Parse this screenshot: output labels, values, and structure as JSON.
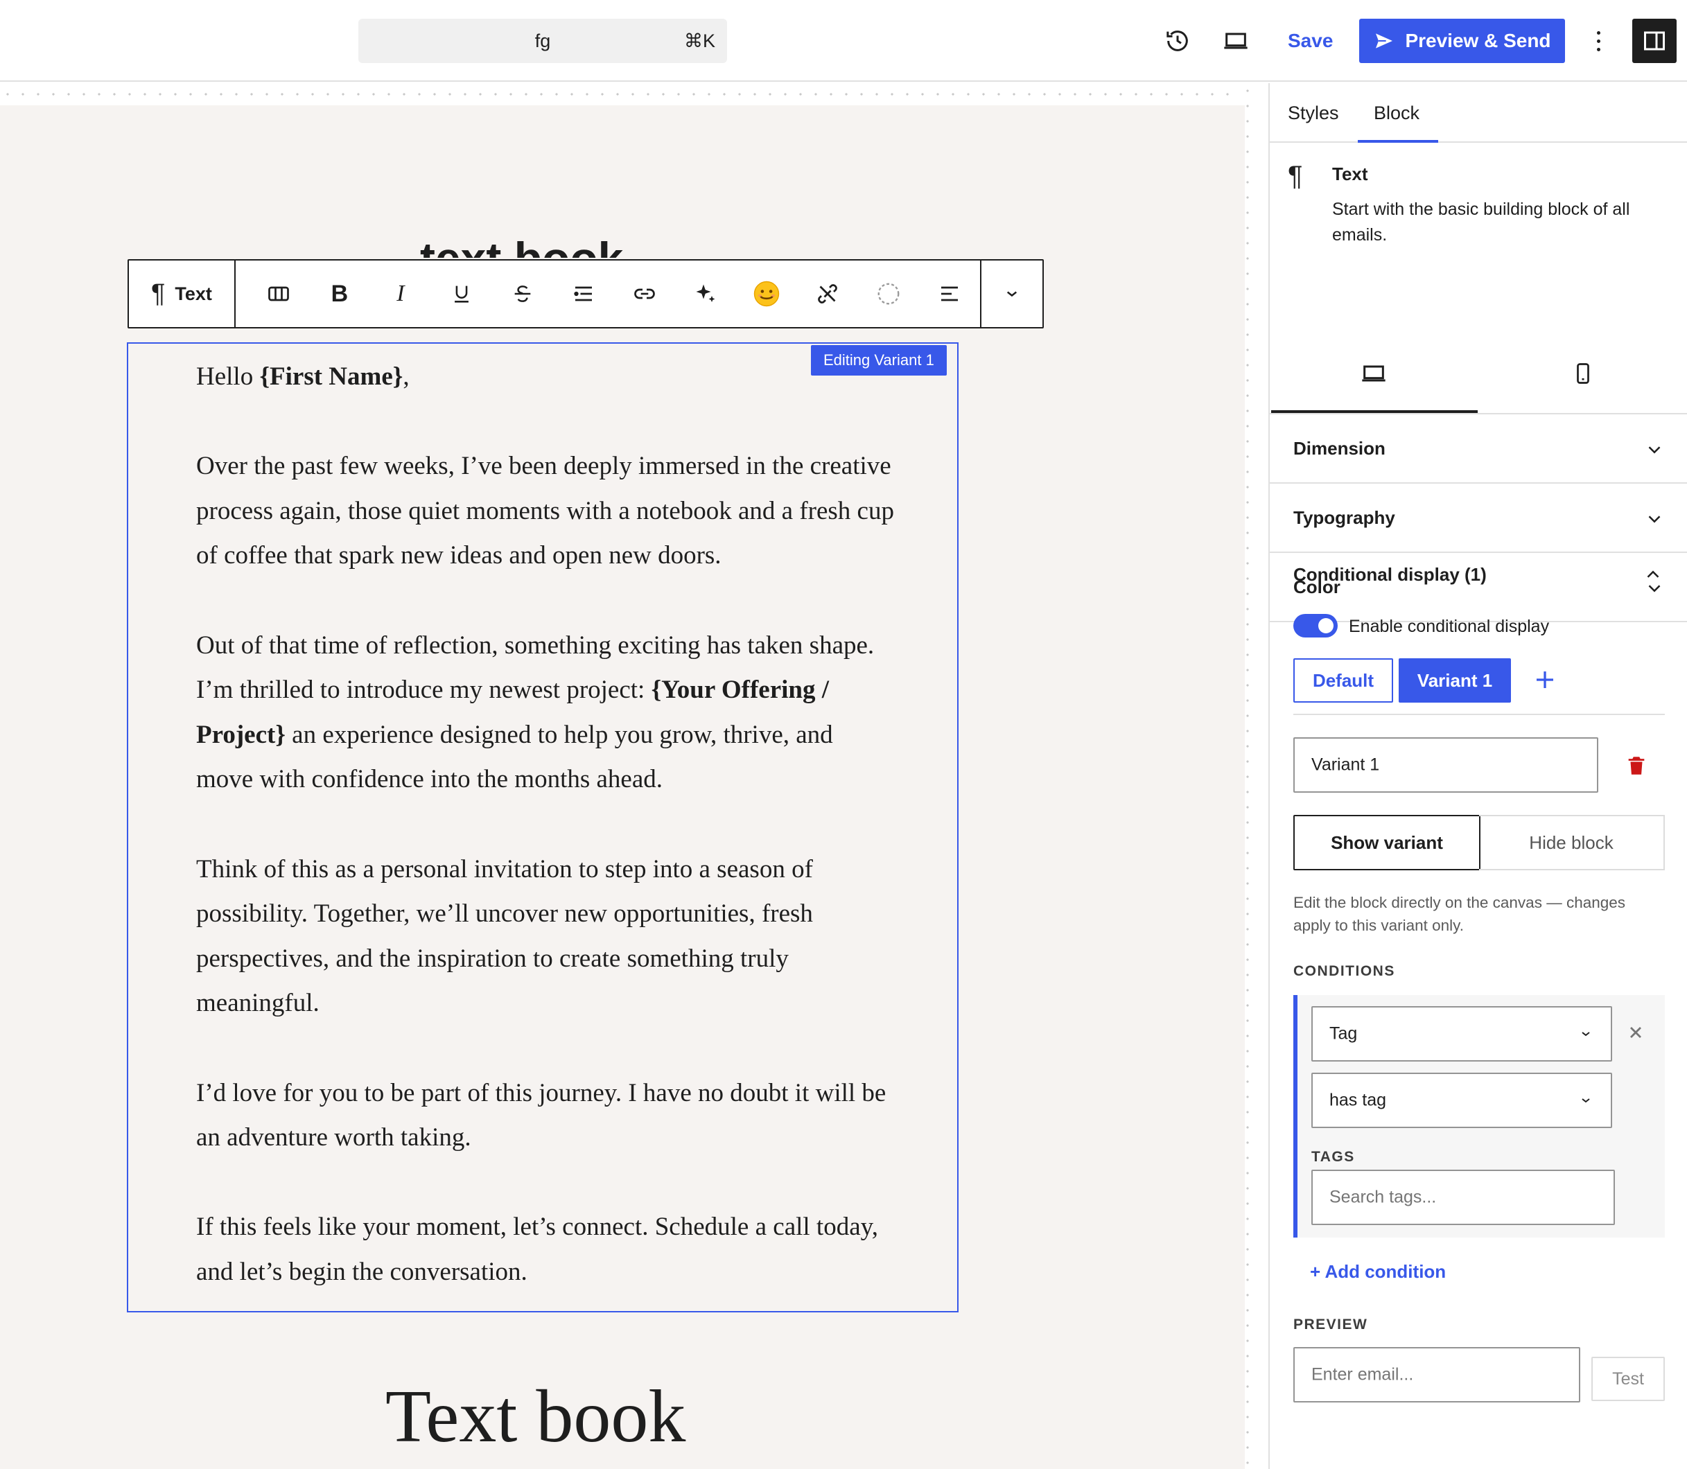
{
  "topbar": {
    "command_text": "fg",
    "command_shortcut": "⌘K",
    "save_label": "Save",
    "send_label": "Preview & Send",
    "icons": [
      "history-icon",
      "desktop-preview-icon",
      "send-icon",
      "more-vertical-icon",
      "sidebar-toggle-icon"
    ]
  },
  "canvas": {
    "heading_top": "text book",
    "toolbar": {
      "block_label": "Text",
      "tools": [
        "columns-icon",
        "bold-icon",
        "italic-icon",
        "underline-icon",
        "strikethrough-icon",
        "list-icon",
        "link-icon",
        "ai-sparkle-icon",
        "emoji-icon",
        "unlink-icon",
        "circle-dashed-icon",
        "align-icon",
        "chevron-down-icon"
      ]
    },
    "badge": "Editing Variant 1",
    "email": {
      "p1_pre": "Hello ",
      "p1_bold": "{First Name}",
      "p1_post": ",",
      "p2": "Over the past few weeks, I’ve been deeply immersed in the creative process again, those quiet moments with a notebook and a fresh cup of coffee that spark new ideas and open new doors.",
      "p3_pre": "Out of that time of reflection, something exciting has taken shape. I’m thrilled to introduce my newest project: ",
      "p3_bold": "{Your Offering / Project}",
      "p3_post": " an experience designed to help you grow, thrive, and move with confidence into the months ahead.",
      "p4": "Think of this as a personal invitation to step into a season of possibility. Together, we’ll uncover new opportunities, fresh perspectives, and the inspiration to create something truly meaningful.",
      "p5": "I’d love for you to be part of this journey. I have no doubt it will be an adventure worth taking.",
      "p6": "If this feels like your moment, let’s connect. Schedule a call today, and let’s begin the conversation."
    },
    "heading_bottom": "Text book"
  },
  "sidebar": {
    "tabs": [
      "Styles",
      "Block"
    ],
    "active_tab": "Block",
    "block_title": "Text",
    "block_desc": "Start with the basic building block of all emails.",
    "devices": [
      "desktop-icon",
      "mobile-icon"
    ],
    "panels": [
      "Dimension",
      "Typography",
      "Color"
    ],
    "conditional": {
      "title": "Conditional display (1)",
      "toggle_label": "Enable conditional display",
      "enabled": true,
      "variants": [
        "Default",
        "Variant 1"
      ],
      "active_variant": "Variant 1",
      "variant_name": "Variant 1",
      "show_label": "Show variant",
      "hide_label": "Hide block",
      "help": "Edit the block directly on the canvas — changes apply to this variant only.",
      "conditions_label": "CONDITIONS",
      "condition_field": "Tag",
      "condition_operator": "has tag",
      "tags_label": "TAGS",
      "tags_placeholder": "Search tags...",
      "add_condition": "+ Add condition",
      "preview_label": "PREVIEW",
      "email_placeholder": "Enter email...",
      "test_label": "Test"
    }
  },
  "colors": {
    "accent": "#3858e9",
    "danger": "#cc1818",
    "paper": "#f6f3f1"
  }
}
